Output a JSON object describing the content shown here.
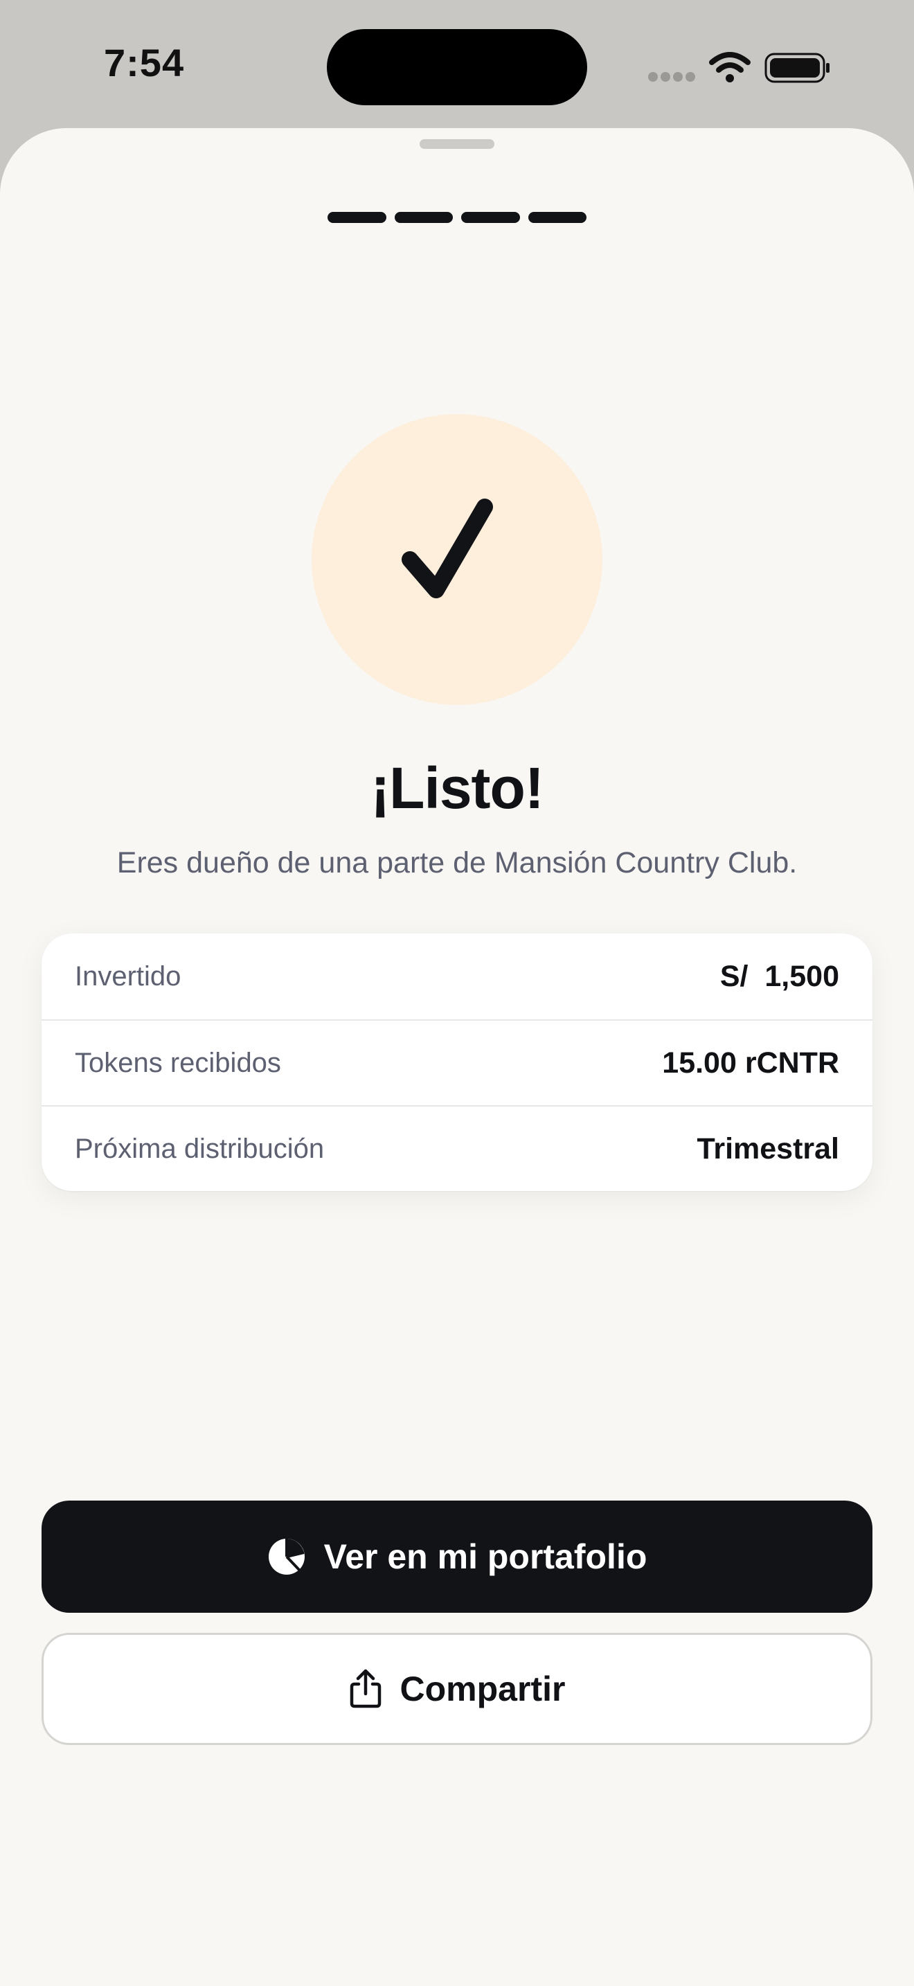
{
  "status_bar": {
    "time": "7:54",
    "icons": [
      "cellular-signal-icon",
      "wifi-icon",
      "battery-icon"
    ]
  },
  "onboarding_progress": {
    "steps_total": 4,
    "steps_completed": 4
  },
  "success": {
    "icon": "checkmark-icon",
    "title": "¡Listo!",
    "subtitle": "Eres dueño de una parte de Mansión Country Club."
  },
  "summary": {
    "rows": [
      {
        "label": "Invertido",
        "value": "S/  1,500"
      },
      {
        "label": "Tokens recibidos",
        "value": "15.00 rCNTR"
      },
      {
        "label": "Próxima distribución",
        "value": "Trimestral"
      }
    ]
  },
  "actions": {
    "primary": {
      "label": "Ver en mi portafolio",
      "icon": "pie-chart-icon"
    },
    "secondary": {
      "label": "Compartir",
      "icon": "share-icon"
    }
  },
  "colors": {
    "sheet_background": "#f8f7f4",
    "accent_circle": "#fdefdc",
    "primary_button": "#121317",
    "text_primary": "#111216",
    "text_secondary": "#5d6070"
  }
}
